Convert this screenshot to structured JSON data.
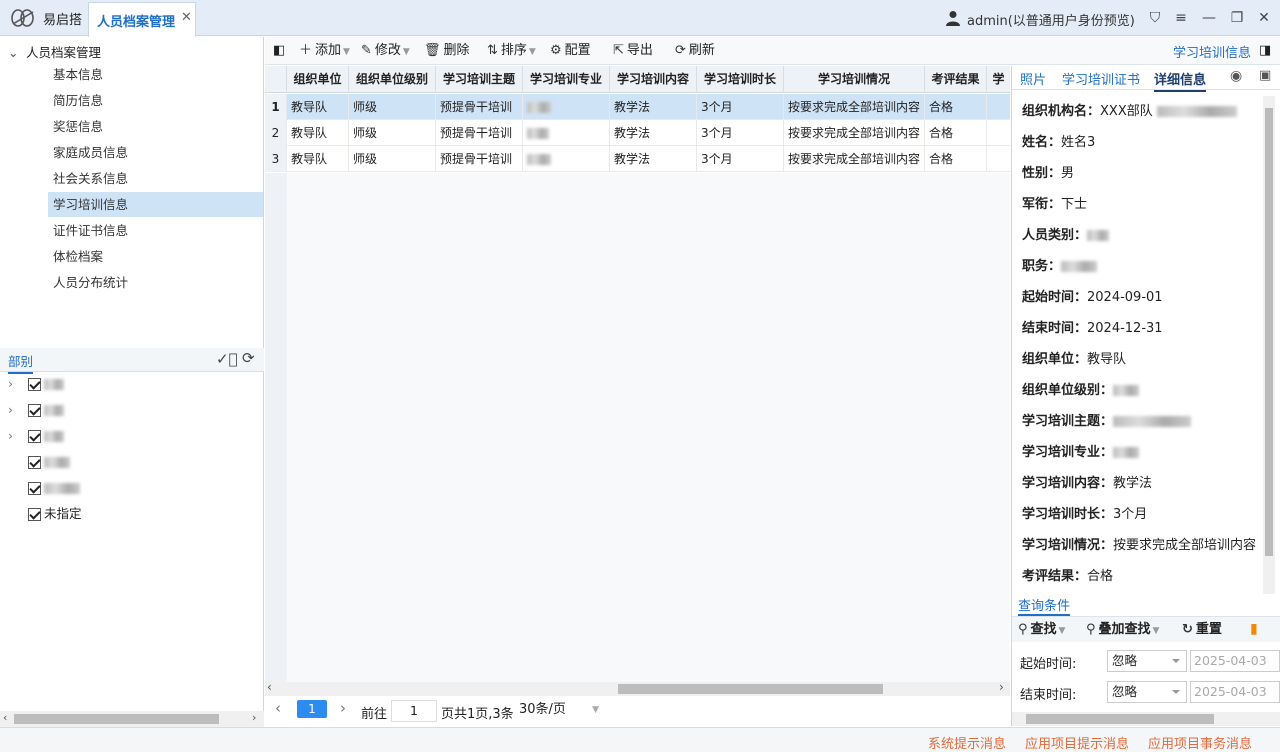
{
  "app": {
    "name": "易启搭",
    "tab_label": "人员档案管理",
    "user": "admin(以普通用户身份预览)"
  },
  "nav": {
    "root": "人员档案管理",
    "items": [
      "基本信息",
      "简历信息",
      "奖惩信息",
      "家庭成员信息",
      "社会关系信息",
      "学习培训信息",
      "证件证书信息",
      "体检档案",
      "人员分布统计"
    ],
    "active_index": 5
  },
  "dept": {
    "title": "部别",
    "last_item": "未指定"
  },
  "toolbar": {
    "add": "添加",
    "edit": "修改",
    "delete": "删除",
    "sort": "排序",
    "config": "配置",
    "export": "导出",
    "refresh": "刷新",
    "panel_title": "学习培训信息"
  },
  "grid": {
    "columns": [
      "组织单位",
      "组织单位级别",
      "学习培训主题",
      "学习培训专业",
      "学习培训内容",
      "学习培训时长",
      "学习培训情况",
      "考评结果",
      "学"
    ],
    "rows": [
      {
        "num": "1",
        "unit": "教导队",
        "level": "师级",
        "topic": "预提骨干培训",
        "content": "教学法",
        "duration": "3个月",
        "status": "按要求完成全部培训内容",
        "result": "合格"
      },
      {
        "num": "2",
        "unit": "教导队",
        "level": "师级",
        "topic": "预提骨干培训",
        "content": "教学法",
        "duration": "3个月",
        "status": "按要求完成全部培训内容",
        "result": "合格"
      },
      {
        "num": "3",
        "unit": "教导队",
        "level": "师级",
        "topic": "预提骨干培训",
        "content": "教学法",
        "duration": "3个月",
        "status": "按要求完成全部培训内容",
        "result": "合格"
      }
    ]
  },
  "pager": {
    "current": "1",
    "goto_label": "前往",
    "goto_value": "1",
    "summary": "页共1页,3条",
    "page_size": "30条/页"
  },
  "right_tabs": [
    "照片",
    "学习培训证书",
    "详细信息"
  ],
  "detail": [
    {
      "label": "组织机构名：",
      "value": "XXX部队"
    },
    {
      "label": "姓名：",
      "value": "姓名3"
    },
    {
      "label": "性别：",
      "value": "男"
    },
    {
      "label": "军衔：",
      "value": "下士"
    },
    {
      "label": "人员类别：",
      "value": ""
    },
    {
      "label": "职务：",
      "value": ""
    },
    {
      "label": "起始时间：",
      "value": "2024-09-01"
    },
    {
      "label": "结束时间：",
      "value": "2024-12-31"
    },
    {
      "label": "组织单位：",
      "value": "教导队"
    },
    {
      "label": "组织单位级别：",
      "value": ""
    },
    {
      "label": "学习培训主题：",
      "value": ""
    },
    {
      "label": "学习培训专业：",
      "value": ""
    },
    {
      "label": "学习培训内容：",
      "value": "教学法"
    },
    {
      "label": "学习培训时长：",
      "value": "3个月"
    },
    {
      "label": "学习培训情况：",
      "value": "按要求完成全部培训内容"
    },
    {
      "label": "考评结果：",
      "value": "合格"
    }
  ],
  "query": {
    "title": "查询条件",
    "search": "查找",
    "overlay": "叠加查找",
    "reset": "重置",
    "start_label": "起始时间:",
    "end_label": "结束时间:",
    "start_mode": "忽略",
    "end_mode": "忽略",
    "start_date": "2025-04-03",
    "end_date": "2025-04-03"
  },
  "status": {
    "sys": "系统提示消息",
    "app": "应用项目提示消息",
    "task": "应用项目事务消息"
  },
  "colors": {
    "accent": "#1f6fc4",
    "selected_row": "#cfe3f7",
    "status_text": "#e06b3c"
  }
}
